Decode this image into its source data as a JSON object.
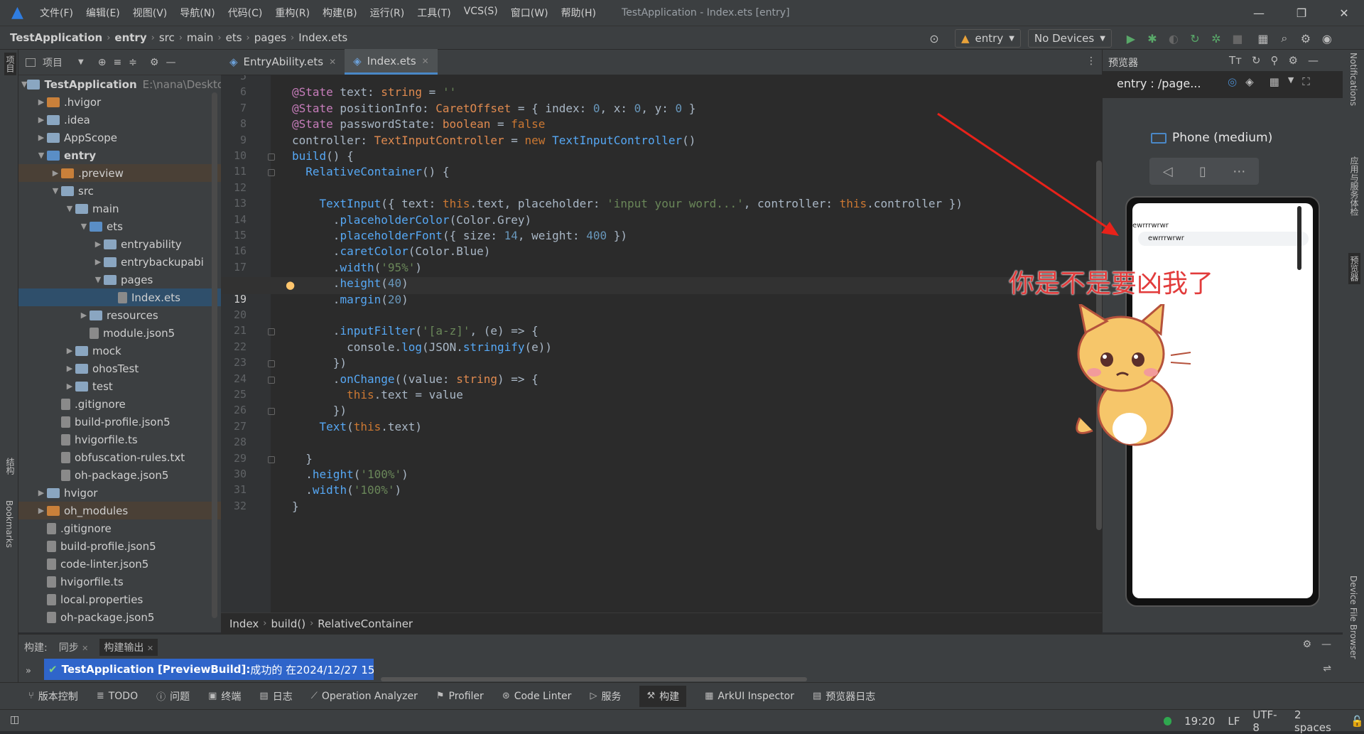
{
  "window": {
    "title": "TestApplication - Index.ets [entry]",
    "menu": [
      "文件(F)",
      "编辑(E)",
      "视图(V)",
      "导航(N)",
      "代码(C)",
      "重构(R)",
      "构建(B)",
      "运行(R)",
      "工具(T)",
      "VCS(S)",
      "窗口(W)",
      "帮助(H)"
    ]
  },
  "navbar": {
    "crumbs": [
      "TestApplication",
      "entry",
      "src",
      "main",
      "ets",
      "pages",
      "Index.ets"
    ],
    "module_selector": "entry",
    "device_selector": "No Devices"
  },
  "project_panel": {
    "title": "项目",
    "root_label": "TestApplication",
    "root_path": "E:\\nana\\Deskto",
    "items": [
      {
        "label": ".hvigor",
        "depth": 1,
        "type": "folder-orange",
        "arrow": "▶"
      },
      {
        "label": ".idea",
        "depth": 1,
        "type": "folder",
        "arrow": "▶"
      },
      {
        "label": "AppScope",
        "depth": 1,
        "type": "folder",
        "arrow": "▶"
      },
      {
        "label": "entry",
        "depth": 1,
        "type": "folder-blue",
        "arrow": "▼",
        "bold": true
      },
      {
        "label": ".preview",
        "depth": 2,
        "type": "folder-orange",
        "arrow": "▶",
        "hl": true
      },
      {
        "label": "src",
        "depth": 2,
        "type": "folder",
        "arrow": "▼"
      },
      {
        "label": "main",
        "depth": 3,
        "type": "folder",
        "arrow": "▼"
      },
      {
        "label": "ets",
        "depth": 4,
        "type": "folder-blue",
        "arrow": "▼"
      },
      {
        "label": "entryability",
        "depth": 5,
        "type": "folder",
        "arrow": "▶"
      },
      {
        "label": "entrybackupabi",
        "depth": 5,
        "type": "folder",
        "arrow": "▶"
      },
      {
        "label": "pages",
        "depth": 5,
        "type": "folder",
        "arrow": "▼"
      },
      {
        "label": "Index.ets",
        "depth": 6,
        "type": "file",
        "arrow": "",
        "sel": true
      },
      {
        "label": "resources",
        "depth": 4,
        "type": "folder",
        "arrow": "▶"
      },
      {
        "label": "module.json5",
        "depth": 4,
        "type": "file",
        "arrow": ""
      },
      {
        "label": "mock",
        "depth": 3,
        "type": "folder",
        "arrow": "▶"
      },
      {
        "label": "ohosTest",
        "depth": 3,
        "type": "folder",
        "arrow": "▶"
      },
      {
        "label": "test",
        "depth": 3,
        "type": "folder",
        "arrow": "▶"
      },
      {
        "label": ".gitignore",
        "depth": 2,
        "type": "file",
        "arrow": ""
      },
      {
        "label": "build-profile.json5",
        "depth": 2,
        "type": "file",
        "arrow": ""
      },
      {
        "label": "hvigorfile.ts",
        "depth": 2,
        "type": "file",
        "arrow": ""
      },
      {
        "label": "obfuscation-rules.txt",
        "depth": 2,
        "type": "file",
        "arrow": ""
      },
      {
        "label": "oh-package.json5",
        "depth": 2,
        "type": "file",
        "arrow": ""
      },
      {
        "label": "hvigor",
        "depth": 1,
        "type": "folder",
        "arrow": "▶"
      },
      {
        "label": "oh_modules",
        "depth": 1,
        "type": "folder-orange",
        "arrow": "▶",
        "hl": true
      },
      {
        "label": ".gitignore",
        "depth": 1,
        "type": "file",
        "arrow": ""
      },
      {
        "label": "build-profile.json5",
        "depth": 1,
        "type": "file",
        "arrow": ""
      },
      {
        "label": "code-linter.json5",
        "depth": 1,
        "type": "file",
        "arrow": ""
      },
      {
        "label": "hvigorfile.ts",
        "depth": 1,
        "type": "file",
        "arrow": ""
      },
      {
        "label": "local.properties",
        "depth": 1,
        "type": "file",
        "arrow": ""
      },
      {
        "label": "oh-package.json5",
        "depth": 1,
        "type": "file",
        "arrow": ""
      }
    ]
  },
  "editor": {
    "tabs": [
      {
        "label": "EntryAbility.ets",
        "active": false
      },
      {
        "label": "Index.ets",
        "active": true
      }
    ],
    "lines": [
      {
        "num": "5",
        "html": ""
      },
      {
        "num": "6",
        "html": "<span class='st'>@State</span> text: <span class='ty'>string</span> = <span class='s'>''</span>"
      },
      {
        "num": "7",
        "html": "<span class='st'>@State</span> positionInfo: <span class='ty'>CaretOffset</span> = { index: <span class='n'>0</span>, x: <span class='n'>0</span>, y: <span class='n'>0</span> }"
      },
      {
        "num": "8",
        "html": "<span class='st'>@State</span> passwordState: <span class='ty'>boolean</span> = <span class='k'>false</span>"
      },
      {
        "num": "9",
        "html": "controller: <span class='ty'>TextInputController</span> = <span class='k'>new</span> <span class='fn'>TextInputController</span>()"
      },
      {
        "num": "10",
        "html": "<span class='fn'>build</span>() {"
      },
      {
        "num": "11",
        "html": "  <span class='fn'>RelativeContainer</span>() {"
      },
      {
        "num": "12",
        "html": ""
      },
      {
        "num": "13",
        "html": "    <span class='fn'>TextInput</span>({ text: <span class='k'>this</span>.text, placeholder: <span class='s'>'input your word...'</span>, controller: <span class='k'>this</span>.controller })"
      },
      {
        "num": "14",
        "html": "      .<span class='fn'>placeholderColor</span>(Color.Grey)"
      },
      {
        "num": "15",
        "html": "      .<span class='fn'>placeholderFont</span>({ size: <span class='n'>14</span>, weight: <span class='n'>400</span> })"
      },
      {
        "num": "16",
        "html": "      .<span class='fn'>caretColor</span>(Color.Blue)"
      },
      {
        "num": "17",
        "html": "      .<span class='fn'>width</span>(<span class='s'>'95%'</span>)"
      },
      {
        "num": "18",
        "html": "      .<span class='fn'>height</span>(<span class='n'>40</span>)"
      },
      {
        "num": "19",
        "html": "      .<span class='fn'>margin</span>(<span class='n'>20</span>)"
      },
      {
        "num": "20",
        "html": ""
      },
      {
        "num": "21",
        "html": "      .<span class='fn'>inputFilter</span>(<span class='s'>'[a-z]'</span>, (e) => {"
      },
      {
        "num": "22",
        "html": "        console.<span class='fn'>log</span>(JSON.<span class='fn'>stringify</span>(e))"
      },
      {
        "num": "23",
        "html": "      })"
      },
      {
        "num": "24",
        "html": "      .<span class='fn'>onChange</span>((value: <span class='ty'>string</span>) => {"
      },
      {
        "num": "25",
        "html": "        <span class='k'>this</span>.text = value"
      },
      {
        "num": "26",
        "html": "      })"
      },
      {
        "num": "27",
        "html": "    <span class='fn'>Text</span>(<span class='k'>this</span>.text)"
      },
      {
        "num": "28",
        "html": ""
      },
      {
        "num": "29",
        "html": "  }"
      },
      {
        "num": "30",
        "html": "  .<span class='fn'>height</span>(<span class='s'>'100%'</span>)"
      },
      {
        "num": "31",
        "html": "  .<span class='fn'>width</span>(<span class='s'>'100%'</span>)"
      },
      {
        "num": "32",
        "html": "}"
      }
    ],
    "breadcrumb": [
      "Index",
      "build()",
      "RelativeContainer"
    ]
  },
  "previewer": {
    "title": "预览器",
    "route": "entry : /page...",
    "device": "Phone (medium)",
    "phone_text": "ewrrrwrwr",
    "phone_input": "ewrrrwrwr",
    "sticker_text": "你是不是要凶我了"
  },
  "right_strip": [
    "Notifications",
    "应用与服务体检",
    "预览器",
    "Device File Browser"
  ],
  "left_strip": [
    "项目",
    "结构",
    "Bookmarks"
  ],
  "build_panel": {
    "label": "构建:",
    "tabs": [
      "同步",
      "构建输出"
    ],
    "message_bold": "TestApplication [PreviewBuild]:",
    "message": " 成功的 在2024/12/27 15:"
  },
  "bottom_tools": [
    "版本控制",
    "TODO",
    "问题",
    "终端",
    "日志",
    "Operation Analyzer",
    "Profiler",
    "Code Linter",
    "服务",
    "构建",
    "ArkUI Inspector",
    "预览器日志"
  ],
  "status": {
    "position": "19:20",
    "line_sep": "LF",
    "encoding": "UTF-8",
    "indent": "2 spaces"
  }
}
